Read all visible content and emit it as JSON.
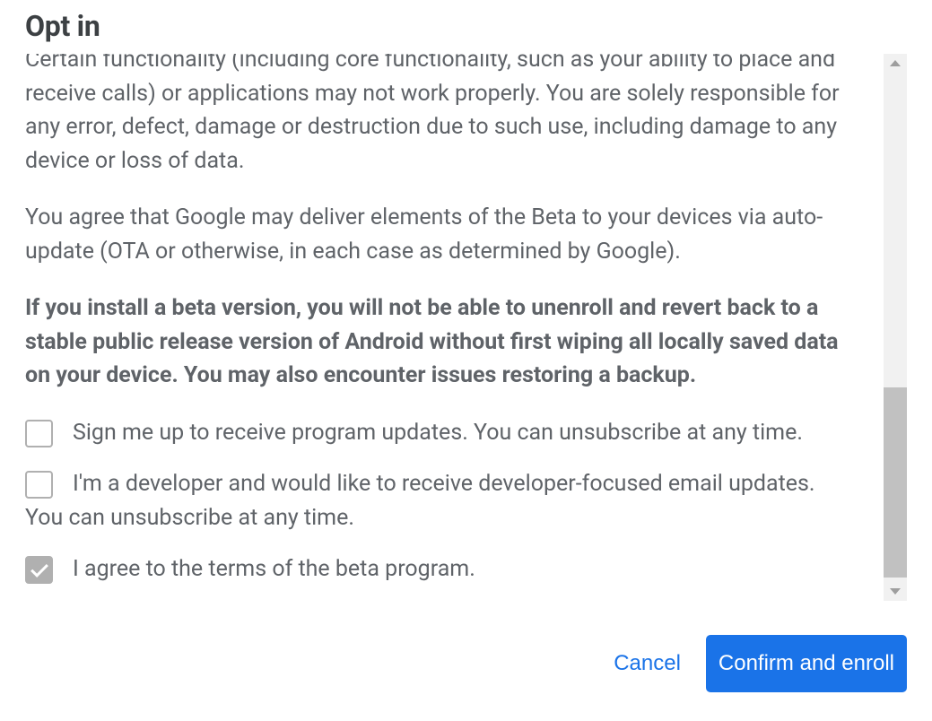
{
  "dialog": {
    "title": "Opt in",
    "paragraphs": {
      "truncated": "Certain functionality (including core functionality, such as your ability to place and receive calls) or applications may not work properly. You are solely responsible for any error, defect, damage or destruction due to such use, including damage to any device or loss of data.",
      "ota": "You agree that Google may deliver elements of the Beta to your devices via auto-update (OTA or otherwise, in each case as determined by Google).",
      "bold_warning": "If you install a beta version, you will not be able to unenroll and revert back to a stable public release version of Android without first wiping all locally saved data on your device. You may also encounter issues restoring a backup."
    },
    "checkboxes": {
      "updates": {
        "label": "Sign me up to receive program updates. You can unsubscribe at any time.",
        "checked": false
      },
      "developer": {
        "label": "I'm a developer and would like to receive developer-focused email updates. You can unsubscribe at any time.",
        "checked": false
      },
      "agree": {
        "label": "I agree to the terms of the beta program.",
        "checked": true
      }
    },
    "buttons": {
      "cancel": "Cancel",
      "confirm": "Confirm and enroll"
    }
  }
}
